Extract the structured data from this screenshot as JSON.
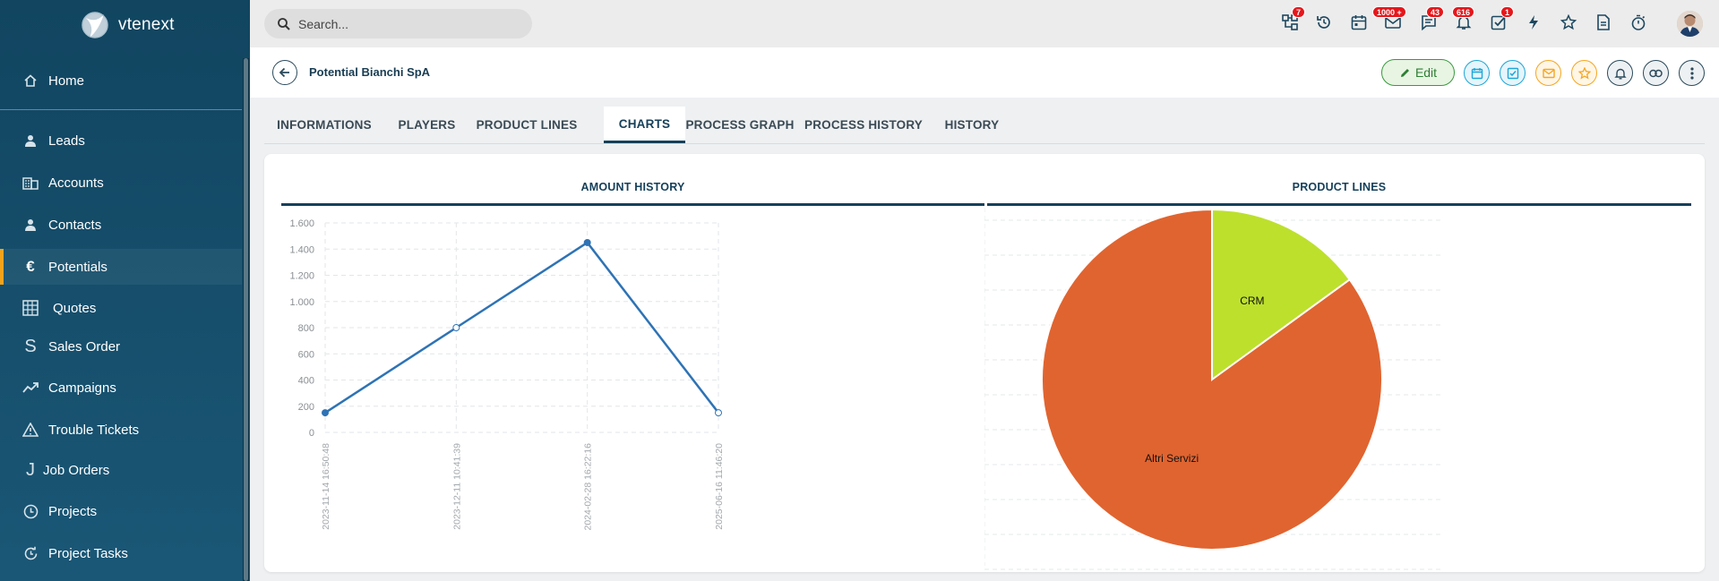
{
  "app": {
    "logo_text": "vtenext"
  },
  "sidebar": {
    "items": [
      {
        "label": "Home",
        "icon": "home-icon"
      },
      {
        "label": "Leads",
        "icon": "person-icon"
      },
      {
        "label": "Accounts",
        "icon": "building-icon"
      },
      {
        "label": "Contacts",
        "icon": "person-icon"
      },
      {
        "label": "Potentials",
        "icon": "euro-icon",
        "active": true
      },
      {
        "label": "Quotes",
        "icon": "calculator-icon"
      },
      {
        "label": "Sales Order",
        "icon": "dollar-icon"
      },
      {
        "label": "Campaigns",
        "icon": "trend-icon"
      },
      {
        "label": "Trouble Tickets",
        "icon": "warning-icon"
      },
      {
        "label": "Job Orders",
        "icon": "hook-icon"
      },
      {
        "label": "Projects",
        "icon": "clock-icon"
      },
      {
        "label": "Project Tasks",
        "icon": "refresh-clock-icon"
      }
    ]
  },
  "topbar": {
    "search": {
      "placeholder": "Search..."
    },
    "badges": {
      "processes": "7",
      "mail": "1000 +",
      "chat": "43",
      "notifications": "616",
      "tasks": "1"
    }
  },
  "header": {
    "title": "Potential Bianchi SpA",
    "edit_label": "Edit"
  },
  "tabs": [
    {
      "label": "INFORMATIONS"
    },
    {
      "label": "PLAYERS"
    },
    {
      "label": "PRODUCT LINES"
    },
    {
      "label": "CHARTS",
      "active": true
    },
    {
      "label": "PROCESS GRAPH"
    },
    {
      "label": "PROCESS HISTORY"
    },
    {
      "label": "HISTORY"
    }
  ],
  "colors": {
    "sidebar": "#114560",
    "accent": "#f2a31c",
    "line": "#2e73b5",
    "pie_orange": "#e06430",
    "pie_green": "#bde02d"
  },
  "chart_data": [
    {
      "type": "line",
      "title": "AMOUNT HISTORY",
      "x": [
        "2023-11-14 16:50:48",
        "2023-12-11 10:41:39",
        "2024-02-28 16:22:16",
        "2025-06-16 11:46:20"
      ],
      "y": [
        150,
        800,
        1450,
        150
      ],
      "ylim": [
        0,
        1600
      ],
      "yticks": [
        "0",
        "200",
        "400",
        "600",
        "800",
        "1.000",
        "1.200",
        "1.400",
        "1.600"
      ],
      "grid": true
    },
    {
      "type": "pie",
      "title": "PRODUCT LINES",
      "slices": [
        {
          "label": "CRM",
          "value": 15
        },
        {
          "label": "Altri Servizi",
          "value": 85
        }
      ]
    }
  ]
}
